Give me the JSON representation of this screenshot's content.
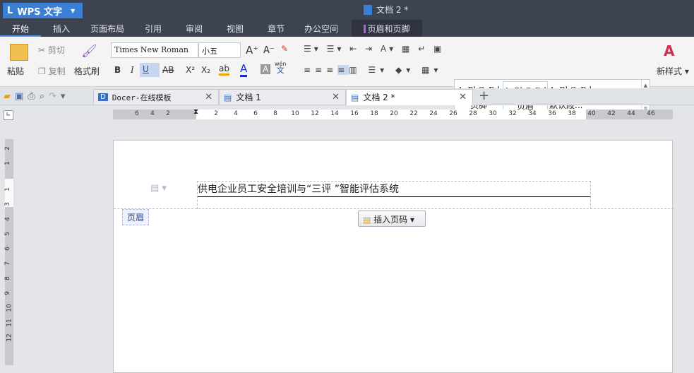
{
  "app": {
    "name": "WPS 文字",
    "doc_title": "文档 2 *"
  },
  "menu": [
    "开始",
    "插入",
    "页面布局",
    "引用",
    "审阅",
    "视图",
    "章节",
    "办公空间",
    "页眉和页脚"
  ],
  "ribbon": {
    "paste": "粘贴",
    "cut": "剪切",
    "copy": "复制",
    "format_painter": "格式刷",
    "font": "Times New Roman",
    "size": "小五",
    "bold": "B",
    "italic": "I",
    "underline": "U",
    "strike": "AB",
    "sup": "X²",
    "sub": "X₂",
    "pinyin": "wén",
    "new_style": "新样式"
  },
  "styles": [
    {
      "sample": "AaBbCcDd",
      "name": "页脚"
    },
    {
      "sample": "AaBbCcDd",
      "name": "页眉"
    },
    {
      "sample": "AaBbCcDd",
      "name": "默认段..."
    }
  ],
  "tabs": [
    {
      "label": "Docer-在线模板"
    },
    {
      "label": "文档 1"
    },
    {
      "label": "文档 2 *"
    }
  ],
  "ruler": [
    "6",
    "4",
    "2",
    "2",
    "4",
    "6",
    "8",
    "10",
    "12",
    "14",
    "16",
    "18",
    "20",
    "22",
    "24",
    "26",
    "28",
    "30",
    "32",
    "34",
    "36",
    "38",
    "40",
    "42",
    "44",
    "46"
  ],
  "vruler": [
    "2",
    "1",
    "1",
    "3",
    "4",
    "5",
    "6",
    "7",
    "8",
    "9",
    "10",
    "11",
    "12"
  ],
  "document": {
    "header_text": "供电企业员工安全培训与“三评 ”智能评估系统",
    "header_label": "页眉",
    "insert_page_number": "插入页码"
  }
}
